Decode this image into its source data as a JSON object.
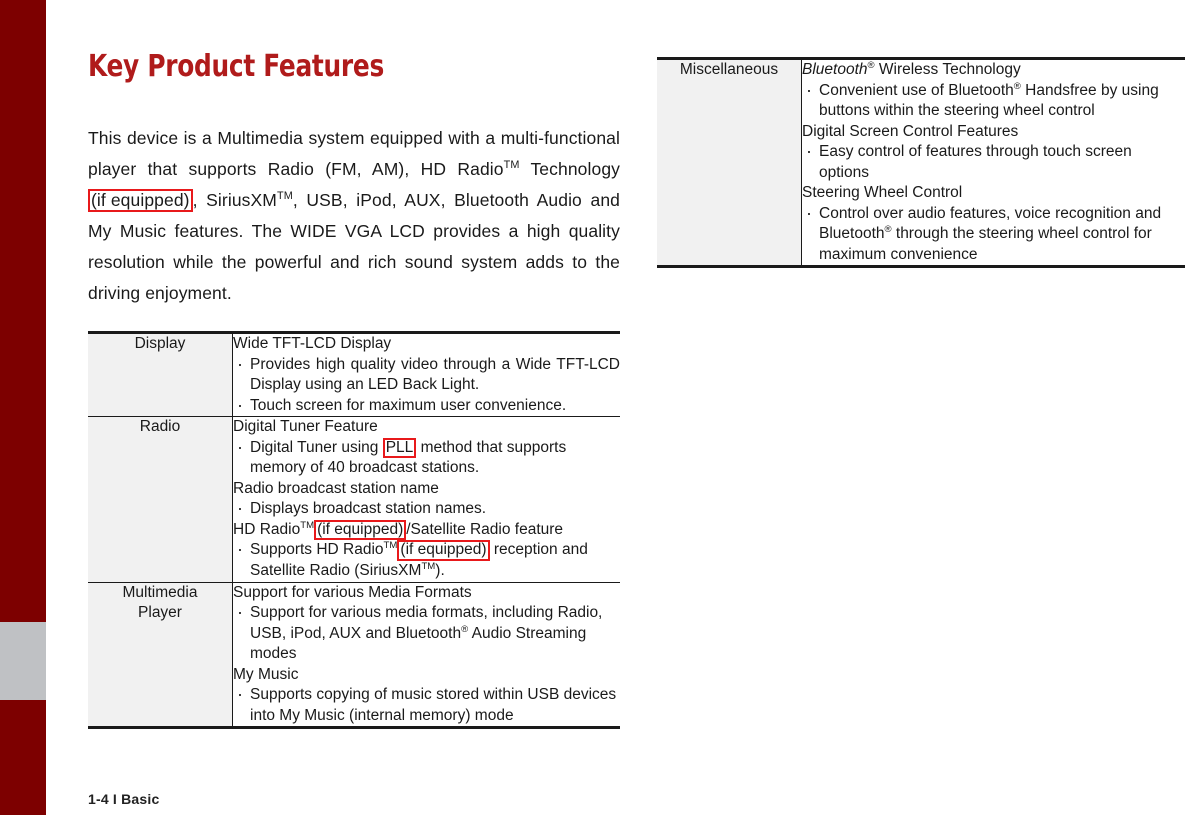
{
  "theme": {
    "accent_red": "#7d0000",
    "title_red": "#b01b1b",
    "marker_red": "#e8191b",
    "label_cell_bg": "#f1f1f1",
    "edge_gray": "#bfc1c4"
  },
  "page_title": "Key Product Features",
  "intro": {
    "part1": "This device is a Multimedia system equipped with a multi-functional player that supports Radio (FM, AM), HD Radio",
    "tm1": "TM",
    "part2": " Technology ",
    "marker": "(if equipped)",
    "part3": ", SiriusXM",
    "tm2": "TM",
    "part4": ", USB, iPod, AUX, Bluetooth Audio and My Music features. The WIDE VGA LCD provides a high quality resolution while the powerful and rich sound system adds to the driving enjoyment."
  },
  "left_table": {
    "rows": [
      {
        "label": "Display",
        "groups": [
          {
            "heading": "Wide TFT-LCD Display",
            "bullets": [
              "Provides high quality video through a Wide TFT-LCD Display using an LED Back Light.",
              "Touch screen for maximum user convenience."
            ]
          }
        ]
      },
      {
        "label": "Radio",
        "groups": [
          {
            "heading": "Digital Tuner Feature",
            "bullet_pre": "Digital Tuner using ",
            "bullet_marker": "PLL",
            "bullet_post": " method that supports memory of 40 broadcast stations."
          },
          {
            "heading": "Radio broadcast station name",
            "bullets": [
              "Displays broadcast station names."
            ]
          },
          {
            "heading_pre": "HD Radio",
            "heading_tm": "TM",
            "heading_marker": "(if equipped)",
            "heading_post": "/Satellite Radio feature",
            "bullet_pre": "Supports HD Radio",
            "bullet_tm": "TM",
            "bullet_marker": "(if equipped)",
            "bullet_post": " reception and Satellite Radio (SiriusXM",
            "bullet_tm2": "TM",
            "bullet_end": ")."
          }
        ]
      },
      {
        "label": "Multimedia Player",
        "label_line1": "Multimedia",
        "label_line2": "Player",
        "groups": [
          {
            "heading": "Support for various Media Formats",
            "bullet_pre": "Support for various media formats, including Radio, USB, iPod, AUX and Bluetooth",
            "bullet_reg": "®",
            "bullet_post": " Audio Streaming modes"
          },
          {
            "heading": "My Music",
            "bullets": [
              "Supports copying of music stored within USB devices into My Music (internal memory) mode"
            ]
          }
        ]
      }
    ]
  },
  "right_table": {
    "rows": [
      {
        "label": "Miscellaneous",
        "groups": [
          {
            "heading_italic": "Bluetooth",
            "heading_reg": "®",
            "heading_rest": " Wireless Technology",
            "bullet_pre": "Convenient use of Bluetooth",
            "bullet_reg": "®",
            "bullet_post": " Handsfree by using buttons within the steering wheel control"
          },
          {
            "heading": "Digital Screen Control Features",
            "bullets": [
              "Easy control of features through touch screen options"
            ]
          },
          {
            "heading": "Steering Wheel Control",
            "bullet_pre": "Control over audio features, voice recognition and Bluetooth",
            "bullet_reg": "®",
            "bullet_post": " through the steering wheel control for maximum convenience"
          }
        ]
      }
    ]
  },
  "footer": "1-4 I Basic"
}
